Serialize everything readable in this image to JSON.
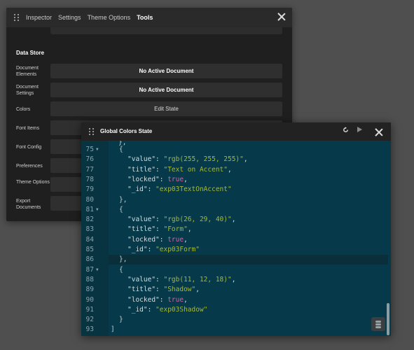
{
  "inspector": {
    "tabs": [
      {
        "label": "Inspector"
      },
      {
        "label": "Settings"
      },
      {
        "label": "Theme Options"
      },
      {
        "label": "Tools"
      }
    ],
    "section_title": "Data Store",
    "rows": [
      {
        "label": "Document Elements",
        "value": "No Active Document"
      },
      {
        "label": "Document Settings",
        "value": "No Active Document"
      },
      {
        "label": "Colors",
        "value": "Edit State"
      },
      {
        "label": "Font Items",
        "value": ""
      },
      {
        "label": "Font Config",
        "value": ""
      },
      {
        "label": "Preferences",
        "value": ""
      },
      {
        "label": "Theme Options",
        "value": ""
      },
      {
        "label": "Export Documents",
        "value": ""
      }
    ]
  },
  "gcs": {
    "title": "Global Colors State",
    "lines": [
      {
        "n": "75",
        "fold": true,
        "text": "{"
      },
      {
        "n": "76",
        "fold": false,
        "key": "\"value\"",
        "val": "\"rgb(255, 255, 255)\"",
        "type": "s",
        "end": ","
      },
      {
        "n": "77",
        "fold": false,
        "key": "\"title\"",
        "val": "\"Text on Accent\"",
        "type": "s",
        "end": ","
      },
      {
        "n": "78",
        "fold": false,
        "key": "\"locked\"",
        "val": "true",
        "type": "b",
        "end": ","
      },
      {
        "n": "79",
        "fold": false,
        "key": "\"_id\"",
        "val": "\"exp03TextOnAccent\"",
        "type": "s",
        "end": ""
      },
      {
        "n": "80",
        "fold": false,
        "text": "},"
      },
      {
        "n": "81",
        "fold": true,
        "text": "{"
      },
      {
        "n": "82",
        "fold": false,
        "key": "\"value\"",
        "val": "\"rgb(26, 29, 40)\"",
        "type": "s",
        "end": ","
      },
      {
        "n": "83",
        "fold": false,
        "key": "\"title\"",
        "val": "\"Form\"",
        "type": "s",
        "end": ","
      },
      {
        "n": "84",
        "fold": false,
        "key": "\"locked\"",
        "val": "true",
        "type": "b",
        "end": ","
      },
      {
        "n": "85",
        "fold": false,
        "key": "\"_id\"",
        "val": "\"exp03Form\"",
        "type": "s",
        "end": ""
      },
      {
        "n": "86",
        "fold": false,
        "text": "},"
      },
      {
        "n": "87",
        "fold": true,
        "text": "{"
      },
      {
        "n": "88",
        "fold": false,
        "key": "\"value\"",
        "val": "\"rgb(11, 12, 18)\"",
        "type": "s",
        "end": ","
      },
      {
        "n": "89",
        "fold": false,
        "key": "\"title\"",
        "val": "\"Shadow\"",
        "type": "s",
        "end": ","
      },
      {
        "n": "90",
        "fold": false,
        "key": "\"locked\"",
        "val": "true",
        "type": "b",
        "end": ","
      },
      {
        "n": "91",
        "fold": false,
        "key": "\"_id\"",
        "val": "\"exp03Shadow\"",
        "type": "s",
        "end": ""
      },
      {
        "n": "92",
        "fold": false,
        "text": "}"
      },
      {
        "n": "93",
        "fold": false,
        "text": "]"
      }
    ],
    "highlight_line": "86"
  },
  "colors": {
    "backdrop": "#4f4f4f",
    "panel": "#1f1f1f",
    "editor_bg": "#063a4a",
    "string": "#a5b83a",
    "boolean": "#d45fa2"
  }
}
